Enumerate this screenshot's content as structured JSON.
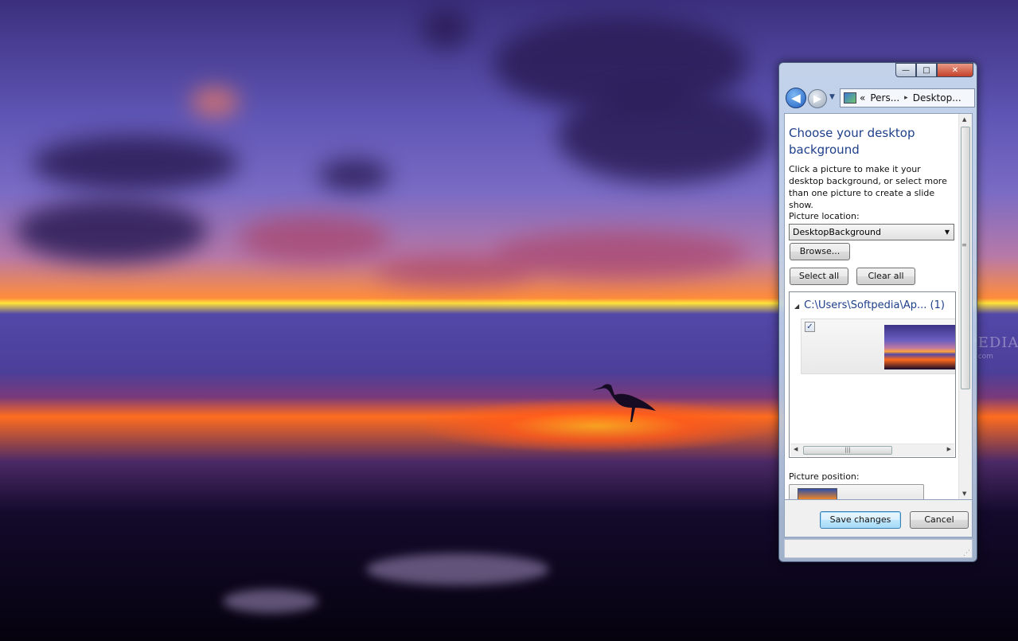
{
  "window": {
    "caption_buttons": {
      "minimize": "—",
      "maximize": "□",
      "close": "✕"
    },
    "navigation": {
      "back_glyph": "◀",
      "forward_glyph": "▶",
      "history_glyph": "▼",
      "breadcrumb_prefix": "«",
      "breadcrumb": [
        "Pers...",
        "Desktop..."
      ],
      "separator": "▸"
    },
    "heading": "Choose your desktop background",
    "description": "Click a picture to make it your desktop background, or select more than one picture to create a slide show.",
    "picture_location_label": "Picture location:",
    "picture_location_value": "DesktopBackground",
    "browse_label": "Browse...",
    "select_all_label": "Select all",
    "clear_all_label": "Clear all",
    "group_title": "C:\\Users\\Softpedia\\Ap... (1)",
    "thumbnail": {
      "checked": true,
      "check_glyph": "✓"
    },
    "picture_position_label": "Picture position:",
    "save_label": "Save changes",
    "cancel_label": "Cancel"
  },
  "watermark": {
    "brand": "SOFTPEDIA",
    "url": "www.softpedia.com"
  },
  "colors": {
    "heading": "#1e3f8a",
    "default_button_border": "#3c7fb1",
    "close_button": "#c4412a"
  },
  "icons": [
    "back-arrow-icon",
    "forward-arrow-icon",
    "control-panel-icon",
    "breadcrumb-chevron-icon",
    "checkbox-check-icon",
    "dropdown-arrow-icon",
    "collapse-triangle-icon"
  ]
}
